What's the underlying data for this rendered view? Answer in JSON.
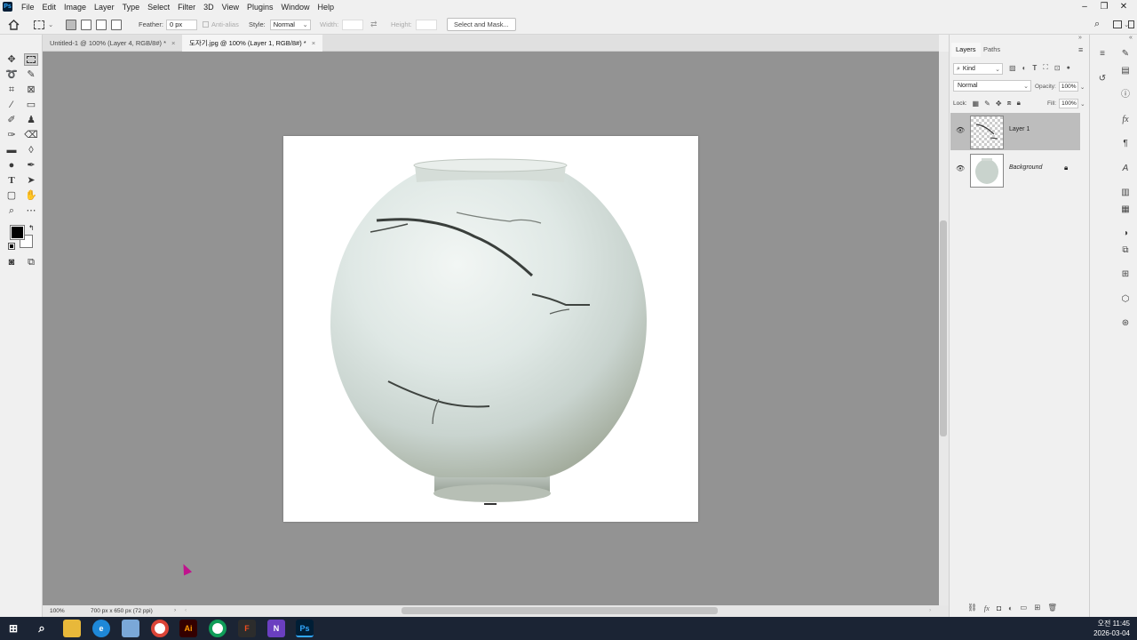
{
  "app": {
    "logo": "Ps"
  },
  "menu": [
    "File",
    "Edit",
    "Image",
    "Layer",
    "Type",
    "Select",
    "Filter",
    "3D",
    "View",
    "Plugins",
    "Window",
    "Help"
  ],
  "window_controls": {
    "minimize": "–",
    "restore": "❐",
    "close": "✕"
  },
  "options_bar": {
    "feather_label": "Feather:",
    "feather_value": "0 px",
    "anti_alias_label": "Anti-alias",
    "style_label": "Style:",
    "style_value": "Normal",
    "width_label": "Width:",
    "height_label": "Height:",
    "select_mask_label": "Select and Mask..."
  },
  "tabs": [
    {
      "label": "Untitled-1 @ 100% (Layer 4, RGB/8#) *",
      "active": false
    },
    {
      "label": "도자기.jpg @ 100% (Layer 1, RGB/8#) *",
      "active": true
    }
  ],
  "status": {
    "zoom": "100%",
    "doc_size": "700 px x 650 px (72 ppi)"
  },
  "layers_panel": {
    "tabs": [
      "Layers",
      "Paths"
    ],
    "filter_value": "Kind",
    "blend_mode": "Normal",
    "opacity_label": "Opacity:",
    "opacity_value": "100%",
    "lock_label": "Lock:",
    "fill_label": "Fill:",
    "fill_value": "100%",
    "layers": [
      {
        "name": "Layer 1",
        "selected": true,
        "visible": true
      },
      {
        "name": "Background",
        "selected": false,
        "visible": true,
        "locked": true
      }
    ]
  },
  "taskbar": {
    "apps": [
      "start",
      "search",
      "file-explorer",
      "edge",
      "files",
      "chrome",
      "illustrator",
      "chrome-2",
      "figma",
      "visual-studio",
      "photoshop"
    ],
    "time": "오전 11:45",
    "date": "2026-03-04"
  },
  "colors": {
    "canvas_bg": "#939393",
    "accent": "#31a8ff",
    "taskbar": "#1b2434",
    "cursor": "#c0138d"
  }
}
